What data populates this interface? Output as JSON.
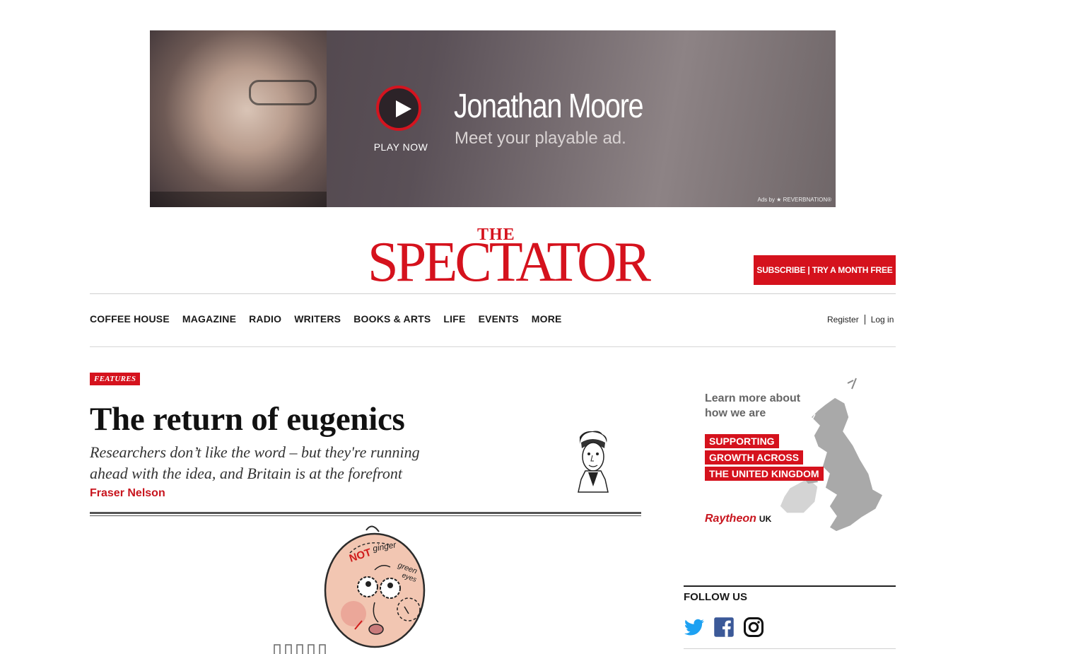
{
  "ad": {
    "artist": "Jonathan Moore",
    "tagline": "Meet your playable ad.",
    "play_label": "PLAY NOW",
    "credit": "Ads by ★ REVERBNATION®"
  },
  "masthead": {
    "logo_the": "THE",
    "logo_main": "SPECTATOR",
    "subscribe_label": "SUBSCRIBE | TRY A MONTH FREE"
  },
  "nav": {
    "items": [
      "COFFEE HOUSE",
      "MAGAZINE",
      "RADIO",
      "WRITERS",
      "BOOKS & ARTS",
      "LIFE",
      "EVENTS",
      "MORE"
    ],
    "register": "Register",
    "login": "Log in"
  },
  "article": {
    "section": "FEATURES",
    "headline": "The return of eugenics",
    "standfirst": "Researchers don’t like the word  – but they're running ahead with the idea, and Britain is at the forefront",
    "author": "Fraser Nelson",
    "illustration_text": [
      "NOT",
      "ginger",
      "green",
      "eyes"
    ]
  },
  "sidebar_ad": {
    "learn": "Learn more about how we are",
    "lines": [
      "SUPPORTING",
      "GROWTH ACROSS",
      "THE UNITED KINGDOM"
    ],
    "brand": "Raytheon",
    "brand_suffix": "UK"
  },
  "follow": {
    "title": "FOLLOW US",
    "icons": [
      "twitter-icon",
      "facebook-icon",
      "instagram-icon"
    ]
  },
  "colors": {
    "brand_red": "#d5121d",
    "twitter": "#1da1f2",
    "facebook": "#3b5998"
  }
}
